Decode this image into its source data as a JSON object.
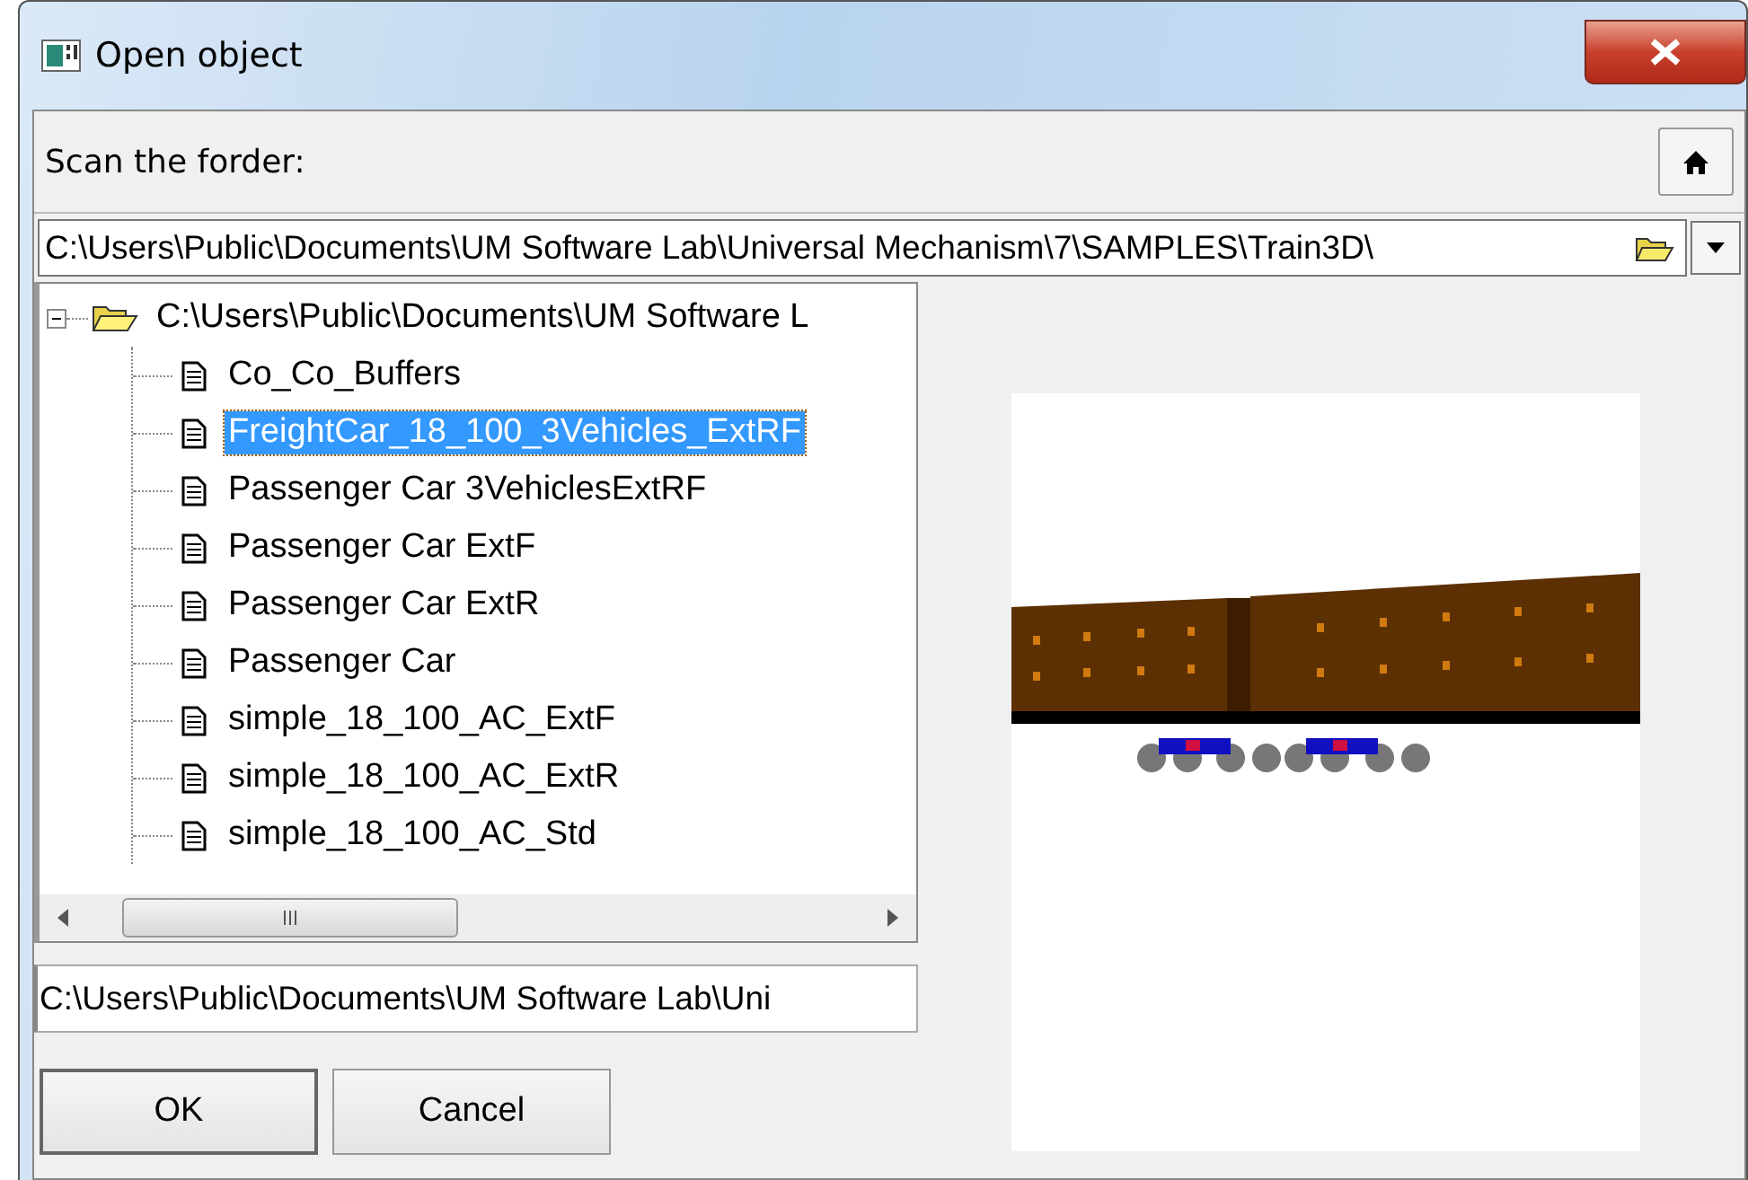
{
  "window": {
    "title": "Open object"
  },
  "scan_label": "Scan the forder:",
  "folder_path": {
    "value": "C:\\Users\\Public\\Documents\\UM Software Lab\\Universal Mechanism\\7\\SAMPLES\\Train3D\\"
  },
  "tree": {
    "root": {
      "label": "C:\\Users\\Public\\Documents\\UM Software L",
      "expanded": true,
      "children": [
        {
          "label": "Co_Co_Buffers",
          "selected": false
        },
        {
          "label": "FreightCar_18_100_3Vehicles_ExtRF",
          "selected": true
        },
        {
          "label": "Passenger Car 3VehiclesExtRF",
          "selected": false
        },
        {
          "label": "Passenger Car ExtF",
          "selected": false
        },
        {
          "label": "Passenger Car ExtR",
          "selected": false
        },
        {
          "label": "Passenger Car",
          "selected": false
        },
        {
          "label": "simple_18_100_AC_ExtF",
          "selected": false
        },
        {
          "label": "simple_18_100_AC_ExtR",
          "selected": false
        },
        {
          "label": "simple_18_100_AC_Std",
          "selected": false
        }
      ]
    }
  },
  "file_path": {
    "value": "C:\\Users\\Public\\Documents\\UM Software Lab\\Uni"
  },
  "buttons": [
    {
      "label": "OK"
    },
    {
      "label": "Cancel"
    }
  ]
}
